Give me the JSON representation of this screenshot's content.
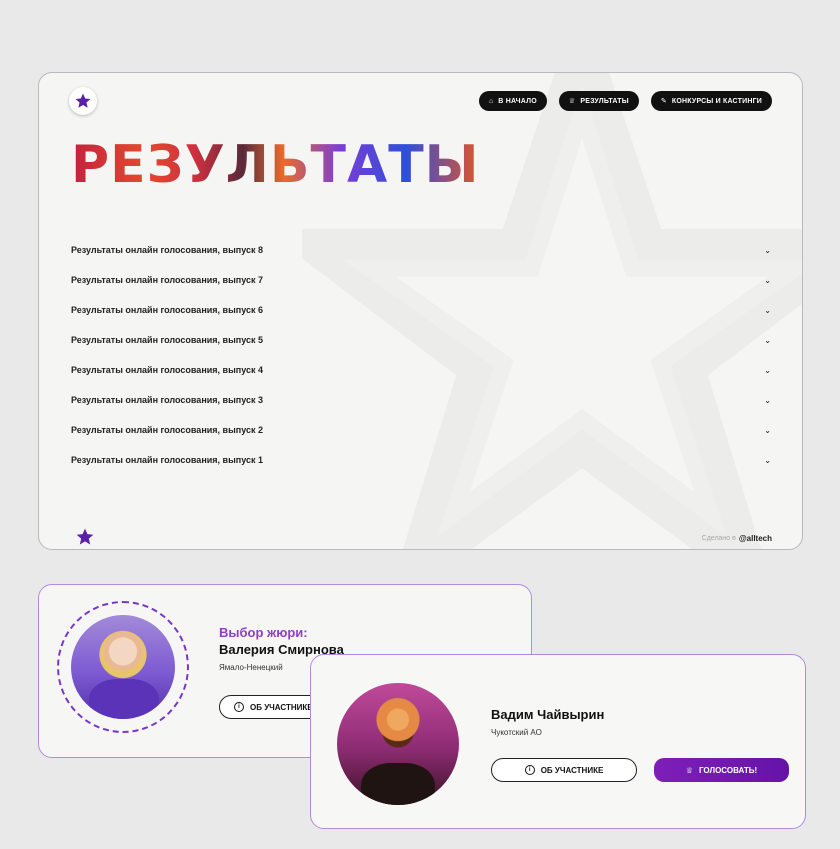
{
  "colors": {
    "accent_purple": "#7a36c8",
    "vote_button": "#6e17ad",
    "nav_button_bg": "#111111",
    "card_border": "#b48ae0"
  },
  "header": {
    "logo_icon": "star-icon",
    "nav": [
      {
        "label": "В начало",
        "icon": "home-icon"
      },
      {
        "label": "Результаты",
        "icon": "trophy-icon"
      },
      {
        "label": "Конкурсы и кастинги",
        "icon": "pencil-icon"
      }
    ]
  },
  "main": {
    "title": "РЕЗУЛЬТАТЫ",
    "results": [
      {
        "label": "Результаты онлайн голосования, выпуск 8"
      },
      {
        "label": "Результаты онлайн голосования, выпуск 7"
      },
      {
        "label": "Результаты онлайн голосования, выпуск 6"
      },
      {
        "label": "Результаты онлайн голосования, выпуск 5"
      },
      {
        "label": "Результаты онлайн голосования, выпуск 4"
      },
      {
        "label": "Результаты онлайн голосования, выпуск 3"
      },
      {
        "label": "Результаты онлайн голосования, выпуск 2"
      },
      {
        "label": "Результаты онлайн голосования, выпуск 1"
      }
    ]
  },
  "footer": {
    "credit_prefix": "Сделано в",
    "credit_brand": "@alltech"
  },
  "jury_card": {
    "label": "Выбор жюри:",
    "name": "Валерия Смирнова",
    "region": "Ямало-Ненецкий",
    "about_label": "ОБ УЧАСТНИКЕ"
  },
  "participant_card": {
    "name": "Вадим Чайвырин",
    "region": "Чукотский АО",
    "about_label": "ОБ УЧАСТНИКЕ",
    "vote_label": "ГОЛОСОВАТЬ!"
  }
}
